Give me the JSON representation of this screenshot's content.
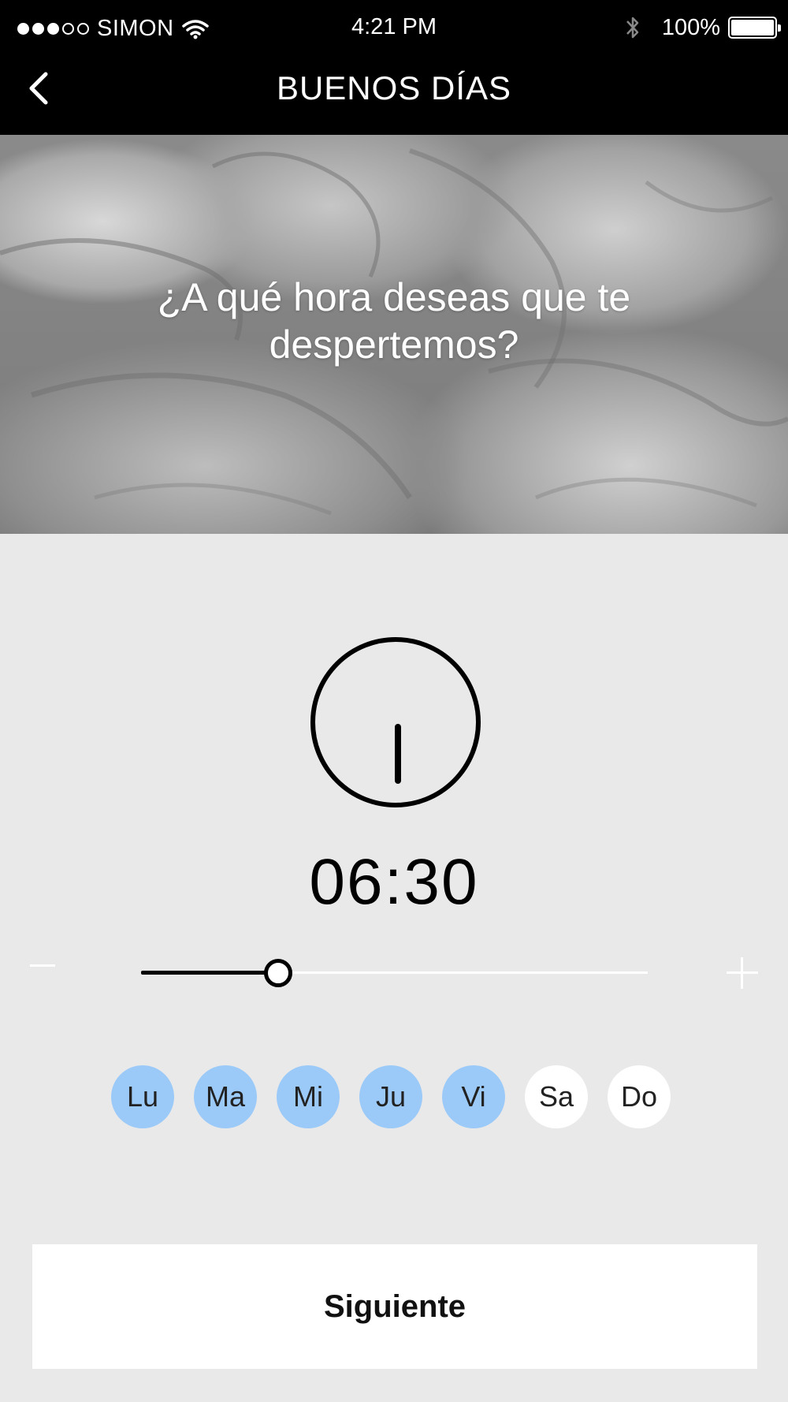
{
  "status_bar": {
    "carrier": "SIMON",
    "time": "4:21 PM",
    "battery": "100%"
  },
  "nav": {
    "title": "BUENOS DÍAS",
    "back_icon": "chevron-left-icon"
  },
  "hero": {
    "question": "¿A qué hora deseas que te despertemos?"
  },
  "alarm": {
    "time": "06:30",
    "slider_level": 0.27,
    "minus_label": "−",
    "plus_label": "+"
  },
  "days": [
    {
      "label": "Lu",
      "selected": true
    },
    {
      "label": "Ma",
      "selected": true
    },
    {
      "label": "Mi",
      "selected": true
    },
    {
      "label": "Ju",
      "selected": true
    },
    {
      "label": "Vi",
      "selected": true
    },
    {
      "label": "Sa",
      "selected": false
    },
    {
      "label": "Do",
      "selected": false
    }
  ],
  "actions": {
    "next_label": "Siguiente"
  },
  "colors": {
    "background": "#e9e9e9",
    "day_selected": "#9ccaf8",
    "day_unselected": "#ffffff",
    "topbar": "#000000"
  }
}
